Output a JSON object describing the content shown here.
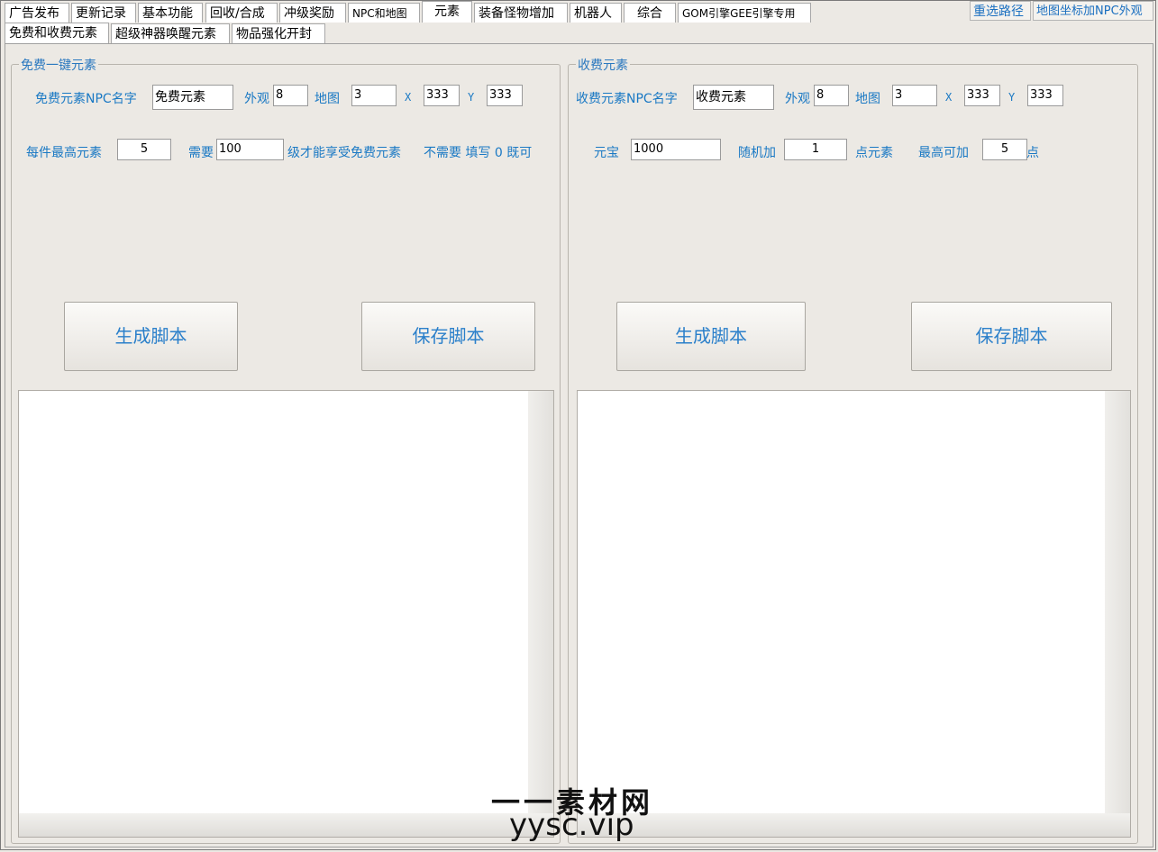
{
  "tabs_top": [
    "广告发布",
    "更新记录",
    "基本功能",
    "回收/合成",
    "冲级奖励",
    "NPC和地图",
    "元素",
    "装备怪物增加",
    "机器人",
    "综合",
    "GOM引擎GEE引擎专用"
  ],
  "top_buttons": {
    "reselect_path": "重选路径",
    "map_npc": "地图坐标加NPC外观"
  },
  "tabs_sub": [
    "免费和收费元素",
    "超级神器唤醒元素",
    "物品强化开封"
  ],
  "free": {
    "group_title": "免费一键元素",
    "npc_name_label": "免费元素NPC名字",
    "npc_name_value": "免费元素",
    "look_label": "外观",
    "look_value": "8",
    "map_label": "地图",
    "map_value": "3",
    "x_label": "X",
    "x_value": "333",
    "y_label": "Y",
    "y_value": "333",
    "max_label": "每件最高元素",
    "max_value": "5",
    "need_label": "需要",
    "need_value": "100",
    "level_label": "级才能享受免费元素",
    "hint_label": "不需要 填写 0 既可",
    "gen_button": "生成脚本",
    "save_button": "保存脚本"
  },
  "paid": {
    "group_title": "收费元素",
    "npc_name_label": "收费元素NPC名字",
    "npc_name_value": "收费元素",
    "look_label": "外观",
    "look_value": "8",
    "map_label": "地图",
    "map_value": "3",
    "x_label": "X",
    "x_value": "333",
    "y_label": "Y",
    "y_value": "333",
    "yuanbao_label": "元宝",
    "yuanbao_value": "1000",
    "random_label": "随机加",
    "random_value": "1",
    "point_label": "点元素",
    "max_label": "最高可加",
    "max_value": "5",
    "max_suffix": "点",
    "gen_button": "生成脚本",
    "save_button": "保存脚本"
  },
  "watermark": {
    "line1": "一一素材网",
    "line2": "yysc.vip"
  }
}
